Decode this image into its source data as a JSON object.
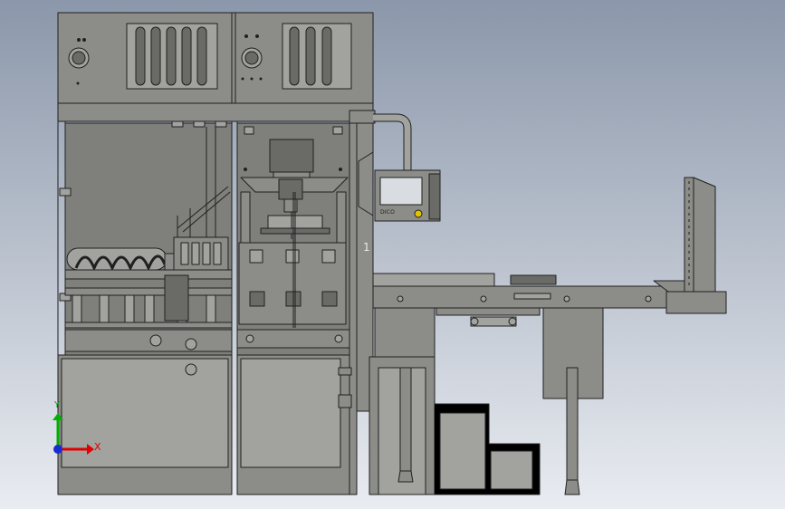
{
  "colors": {
    "background_top": "#8b97aa",
    "background_bottom": "#e9ecf1",
    "body": "#8c8c88",
    "body_light": "#a2a29e",
    "body_dark": "#6a6a67",
    "line": "#202020",
    "glass": "#7f7f7c",
    "screen": "#d9dde2",
    "axis_x": "#e00000",
    "axis_y": "#00b000",
    "axis_origin": "#1a2bd0"
  },
  "labels": {
    "callout_number": "1",
    "axis_x": "X",
    "axis_y": "Y",
    "hmi_buttons": "DICO"
  },
  "icons": {
    "triad": "xyz-axis-triad-icon",
    "hmi": "touch-screen-panel-icon"
  }
}
